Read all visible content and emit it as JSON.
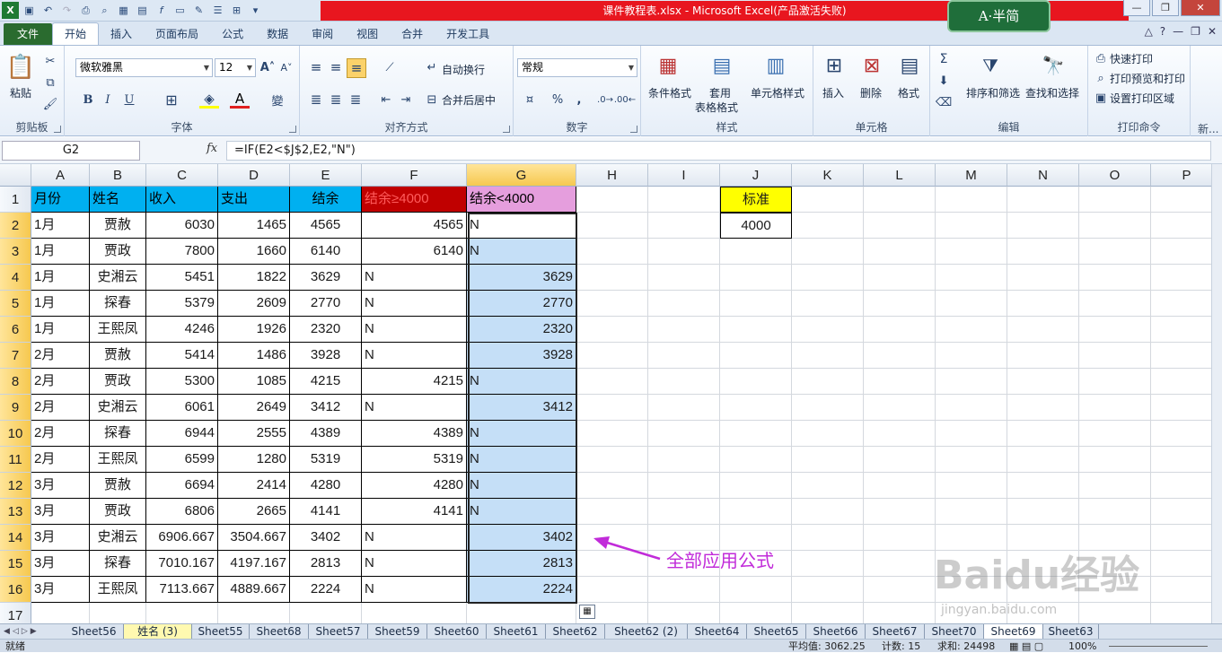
{
  "window": {
    "title": "课件教程表.xlsx - Microsoft Excel(产品激活失败)",
    "logo_text": "A·半简"
  },
  "ribbon_tabs": [
    "文件",
    "开始",
    "插入",
    "页面布局",
    "公式",
    "数据",
    "审阅",
    "视图",
    "合并",
    "开发工具"
  ],
  "clipboard": {
    "paste": "粘贴",
    "label": "剪贴板"
  },
  "font": {
    "name": "微软雅黑",
    "size": "12",
    "bold": "B",
    "italic": "I",
    "underline": "U",
    "label": "字体"
  },
  "alignment": {
    "wrap": "自动换行",
    "merge": "合并后居中",
    "label": "对齐方式"
  },
  "number": {
    "format": "常规",
    "percent": "%",
    "comma": ",",
    "label": "数字"
  },
  "styles": {
    "conditional": "条件格式",
    "table1": "套用",
    "table2": "表格格式",
    "cell_styles": "单元格样式",
    "label": "样式"
  },
  "cells": {
    "insert": "插入",
    "delete": "删除",
    "format": "格式",
    "label": "单元格"
  },
  "editing": {
    "sort": "排序和筛选",
    "find": "查找和选择",
    "label": "编辑"
  },
  "print": {
    "quick": "快速打印",
    "preview": "打印预览和打印",
    "area": "设置打印区域",
    "label": "打印命令",
    "more": "新..."
  },
  "formula_bar": {
    "name_box": "G2",
    "formula": "=IF(E2<$J$2,E2,\"N\")"
  },
  "columns": [
    "A",
    "B",
    "C",
    "D",
    "E",
    "F",
    "G",
    "H",
    "I",
    "J",
    "K",
    "L",
    "M",
    "N",
    "O",
    "P"
  ],
  "rows": [
    "1",
    "2",
    "3",
    "4",
    "5",
    "6",
    "7",
    "8",
    "9",
    "10",
    "11",
    "12",
    "13",
    "14",
    "15",
    "16",
    "17"
  ],
  "headers": [
    "月份",
    "姓名",
    "收入",
    "支出",
    "结余",
    "结余≥4000",
    "结余<4000"
  ],
  "table": [
    [
      "1月",
      "贾赦",
      "6030",
      "1465",
      "4565",
      "4565",
      "N"
    ],
    [
      "1月",
      "贾政",
      "7800",
      "1660",
      "6140",
      "6140",
      "N"
    ],
    [
      "1月",
      "史湘云",
      "5451",
      "1822",
      "3629",
      "N",
      "3629"
    ],
    [
      "1月",
      "探春",
      "5379",
      "2609",
      "2770",
      "N",
      "2770"
    ],
    [
      "1月",
      "王熙凤",
      "4246",
      "1926",
      "2320",
      "N",
      "2320"
    ],
    [
      "2月",
      "贾赦",
      "5414",
      "1486",
      "3928",
      "N",
      "3928"
    ],
    [
      "2月",
      "贾政",
      "5300",
      "1085",
      "4215",
      "4215",
      "N"
    ],
    [
      "2月",
      "史湘云",
      "6061",
      "2649",
      "3412",
      "N",
      "3412"
    ],
    [
      "2月",
      "探春",
      "6944",
      "2555",
      "4389",
      "4389",
      "N"
    ],
    [
      "2月",
      "王熙凤",
      "6599",
      "1280",
      "5319",
      "5319",
      "N"
    ],
    [
      "3月",
      "贾赦",
      "6694",
      "2414",
      "4280",
      "4280",
      "N"
    ],
    [
      "3月",
      "贾政",
      "6806",
      "2665",
      "4141",
      "4141",
      "N"
    ],
    [
      "3月",
      "史湘云",
      "6906.667",
      "3504.667",
      "3402",
      "N",
      "3402"
    ],
    [
      "3月",
      "探春",
      "7010.167",
      "4197.167",
      "2813",
      "N",
      "2813"
    ],
    [
      "3月",
      "王熙凤",
      "7113.667",
      "4889.667",
      "2224",
      "N",
      "2224"
    ]
  ],
  "standard": {
    "label": "标准",
    "value": "4000"
  },
  "annotation": "全部应用公式",
  "watermark": {
    "main": "Baidu经验",
    "sub": "jingyan.baidu.com"
  },
  "sheets": [
    "Sheet56",
    "姓名 (3)",
    "Sheet55",
    "Sheet68",
    "Sheet57",
    "Sheet59",
    "Sheet60",
    "Sheet61",
    "Sheet62",
    "Sheet62 (2)",
    "Sheet64",
    "Sheet65",
    "Sheet66",
    "Sheet67",
    "Sheet70",
    "Sheet69",
    "Sheet63"
  ],
  "status": {
    "ready": "就绪",
    "average": "平均值: 3062.25",
    "count": "计数: 15",
    "sum": "求和: 24498",
    "zoom": "100%"
  },
  "colors": {
    "header_blue": "#00b0f0",
    "header_red": "#c00000",
    "header_pink": "#e59edd",
    "standard_yellow": "#ffff00",
    "selection": "#c5dff7",
    "annotation": "#c12bd9"
  }
}
